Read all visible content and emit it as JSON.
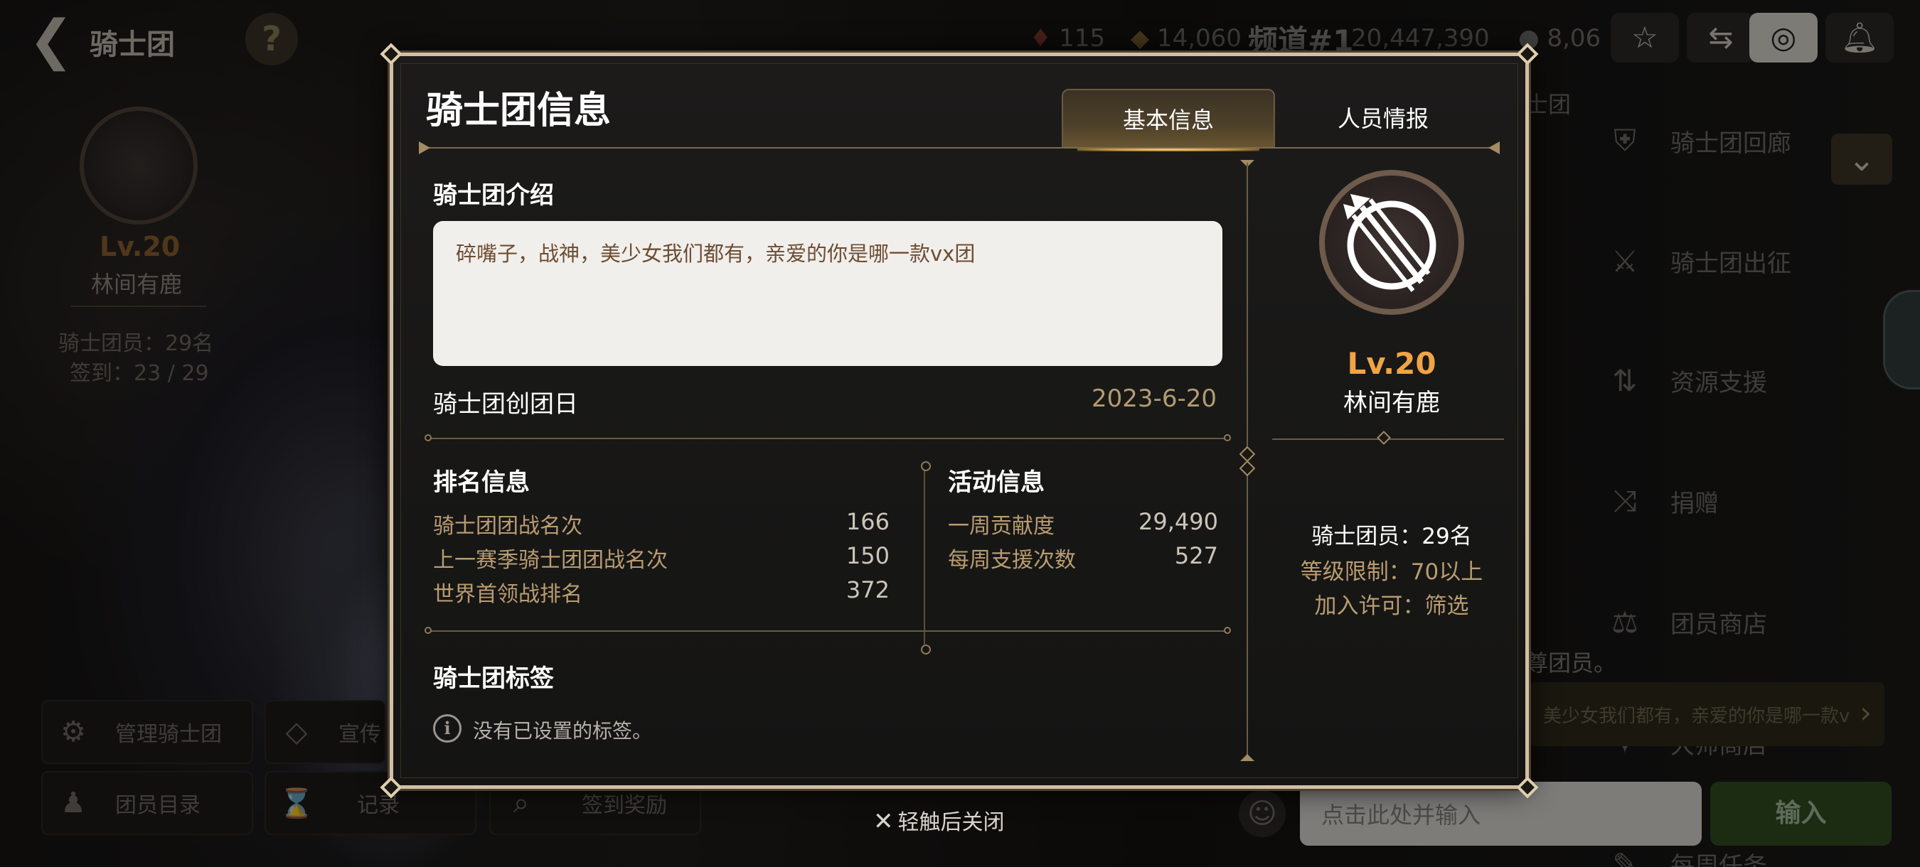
{
  "background": {
    "left_header_title": "骑士团",
    "help_label": "?",
    "stats": [
      "115",
      "14,060"
    ],
    "channel": "频道#1",
    "gold": "20,447,390",
    "gems": "8,06",
    "top_icons": [
      "star-plus-icon",
      "swap-icon",
      "globe-icon",
      "bell-gear-icon"
    ],
    "left_panel": {
      "level": "Lv.20",
      "name": "林间有鹿",
      "members": "骑士团员：29名",
      "checkin": "签到：23 / 29"
    },
    "bottom_buttons": [
      {
        "icon": "gear-icon",
        "label": "管理骑士团"
      },
      {
        "icon": "megaphone-icon",
        "label": "宣传"
      },
      {
        "icon": "person-icon",
        "label": "团员目录"
      },
      {
        "icon": "hourglass-icon",
        "label": "记录"
      },
      {
        "icon": "search-icon",
        "label": "签到奖励"
      }
    ],
    "right_small_label": "士团",
    "right_menu": [
      {
        "icon": "shield-gallery-icon",
        "label": "骑士团回廊"
      },
      {
        "icon": "crossed-swords-icon",
        "label": "骑士团出征"
      },
      {
        "icon": "resource-support-icon",
        "label": "资源支援"
      },
      {
        "icon": "shuffle-icon",
        "label": "捐赠"
      },
      {
        "icon": "scale-icon",
        "label": "团员商店"
      },
      {
        "icon": "master-shop-icon",
        "label": "大师商店"
      },
      {
        "icon": "weekly-task-icon",
        "label": "每周任务"
      }
    ],
    "members_note": "尊团员。",
    "chat_preview": "美少女我们都有，亲爱的你是哪一款v",
    "chat_placeholder": "点击此处并输入",
    "send_label": "输入"
  },
  "modal": {
    "title": "骑士团信息",
    "tabs": [
      {
        "label": "基本信息",
        "active": true
      },
      {
        "label": "人员情报",
        "active": false
      }
    ],
    "intro_title": "骑士团介绍",
    "intro_text": "碎嘴子，战神，美少女我们都有，亲爱的你是哪一款vx团",
    "founded_label": "骑士团创团日",
    "founded_date": "2023-6-20",
    "ranking": {
      "title": "排名信息",
      "rows": [
        {
          "label": "骑士团团战名次",
          "value": "166"
        },
        {
          "label": "上一赛季骑士团团战名次",
          "value": "150"
        },
        {
          "label": "世界首领战排名",
          "value": "372"
        }
      ]
    },
    "activity": {
      "title": "活动信息",
      "rows": [
        {
          "label": "一周贡献度",
          "value": "29,490"
        },
        {
          "label": "每周支援次数",
          "value": "527"
        }
      ]
    },
    "tags_title": "骑士团标签",
    "tags_empty": "没有已设置的标签。",
    "guild": {
      "level": "Lv.20",
      "name": "林间有鹿",
      "members": "骑士团员：29名",
      "level_limit": "等级限制：70以上",
      "join_permission": "加入许可：筛选"
    }
  },
  "close_hint": "轻触后关闭",
  "colors": {
    "accent_gold": "#b99c70",
    "level_orange": "#f0a445",
    "frame": "#d2c0a4"
  }
}
